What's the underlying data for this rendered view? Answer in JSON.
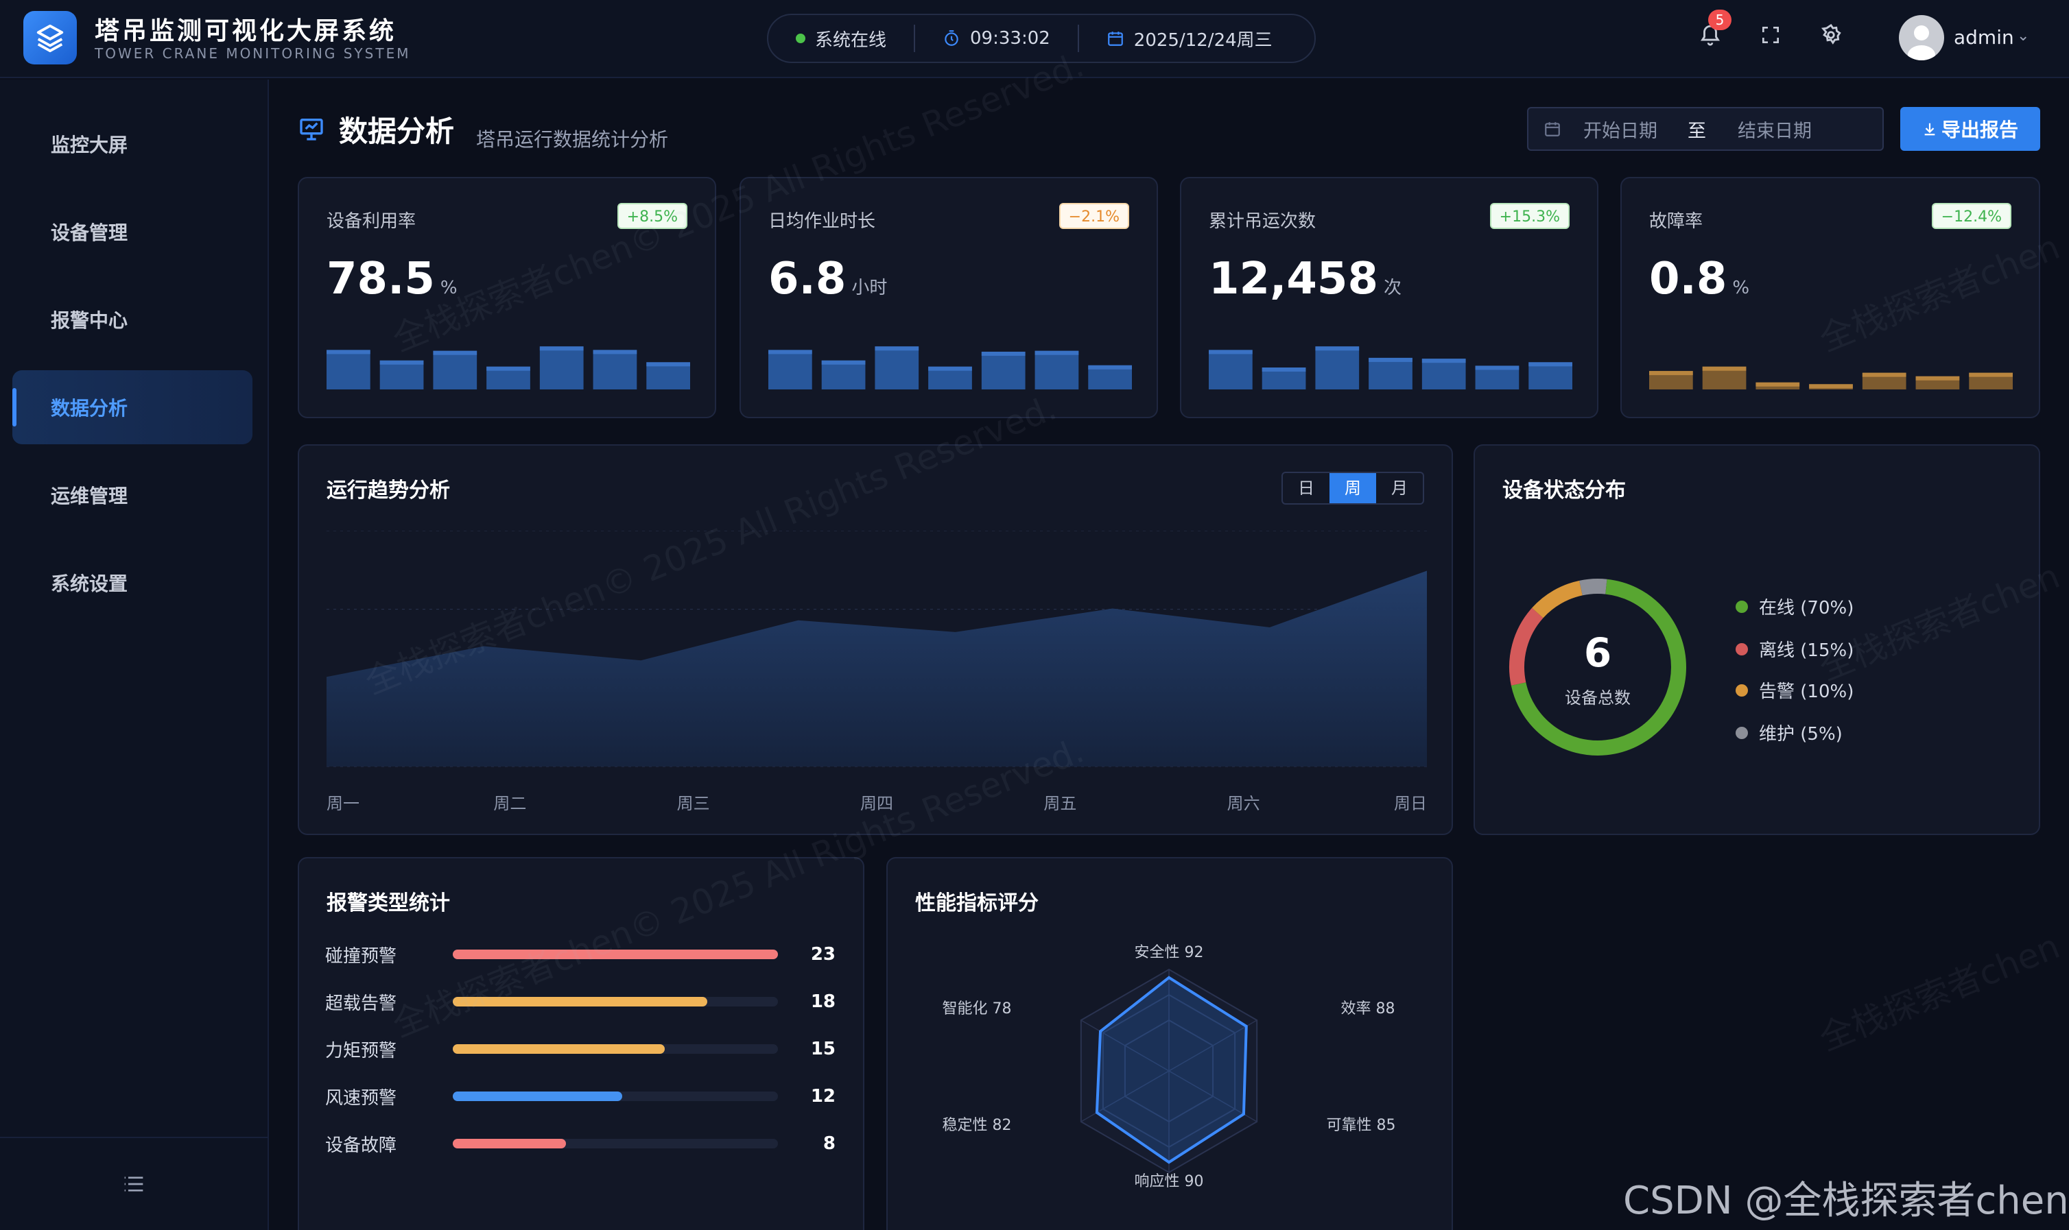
{
  "header": {
    "title": "塔吊监测可视化大屏系统",
    "subtitle": "TOWER CRANE MONITORING SYSTEM",
    "status": "系统在线",
    "time": "09:33:02",
    "date": "2025/12/24周三",
    "notification_count": "5",
    "user": "admin"
  },
  "sidebar": {
    "items": [
      {
        "label": "监控大屏",
        "active": false
      },
      {
        "label": "设备管理",
        "active": false
      },
      {
        "label": "报警中心",
        "active": false
      },
      {
        "label": "数据分析",
        "active": true
      },
      {
        "label": "运维管理",
        "active": false
      },
      {
        "label": "系统设置",
        "active": false
      }
    ]
  },
  "page": {
    "title": "数据分析",
    "subtitle": "塔吊运行数据统计分析",
    "start_placeholder": "开始日期",
    "range_sep": "至",
    "end_placeholder": "结束日期",
    "export_label": "导出报告"
  },
  "kpis": [
    {
      "label": "设备利用率",
      "value": "78.5",
      "unit": "%",
      "change": "+8.5%",
      "trend": "up",
      "color": "#2b5ea8",
      "spark": [
        0.9,
        0.66,
        0.88,
        0.52,
        0.98,
        0.9,
        0.62
      ]
    },
    {
      "label": "日均作业时长",
      "value": "6.8",
      "unit": "小时",
      "change": "−2.1%",
      "trend": "down",
      "color": "#2b5ea8",
      "spark": [
        0.9,
        0.66,
        0.98,
        0.52,
        0.86,
        0.88,
        0.55
      ]
    },
    {
      "label": "累计吊运次数",
      "value": "12,458",
      "unit": "次",
      "change": "+15.3%",
      "trend": "up",
      "color": "#2b5ea8",
      "spark": [
        0.9,
        0.5,
        0.98,
        0.72,
        0.7,
        0.54,
        0.62
      ]
    },
    {
      "label": "故障率",
      "value": "0.8",
      "unit": "%",
      "change": "−12.4%",
      "trend": "up",
      "color": "#8a6331",
      "spark": [
        0.42,
        0.52,
        0.16,
        0.12,
        0.38,
        0.3,
        0.38
      ]
    }
  ],
  "trend": {
    "title": "运行趋势分析",
    "tabs": [
      "日",
      "周",
      "月"
    ],
    "active_tab": "周"
  },
  "status_dist": {
    "title": "设备状态分布",
    "total": "6",
    "total_label": "设备总数",
    "items": [
      {
        "label": "在线 (70%)",
        "pct": 70,
        "color": "#58a631"
      },
      {
        "label": "离线 (15%)",
        "pct": 15,
        "color": "#d45a5a"
      },
      {
        "label": "告警 (10%)",
        "pct": 10,
        "color": "#d9973a"
      },
      {
        "label": "维护 (5%)",
        "pct": 5,
        "color": "#8c8f98"
      }
    ]
  },
  "alarms": {
    "title": "报警类型统计",
    "max": 23,
    "items": [
      {
        "label": "碰撞预警",
        "value": 23,
        "color": "#f47b7b"
      },
      {
        "label": "超载告警",
        "value": 18,
        "color": "#f0b458"
      },
      {
        "label": "力矩预警",
        "value": 15,
        "color": "#f0b458"
      },
      {
        "label": "风速预警",
        "value": 12,
        "color": "#4592f0"
      },
      {
        "label": "设备故障",
        "value": 8,
        "color": "#f47b7b"
      }
    ]
  },
  "performance": {
    "title": "性能指标评分",
    "axes": [
      {
        "label": "安全性",
        "value": 92
      },
      {
        "label": "效率",
        "value": 88
      },
      {
        "label": "可靠性",
        "value": 85
      },
      {
        "label": "响应性",
        "value": 90
      },
      {
        "label": "稳定性",
        "value": 82
      },
      {
        "label": "智能化",
        "value": 78
      }
    ]
  },
  "chart_data": [
    {
      "type": "area",
      "x": [
        "周一",
        "周二",
        "周三",
        "周四",
        "周五",
        "周六",
        "周日"
      ],
      "series": [
        {
          "values": [
            3.8,
            5.1,
            4.5,
            6.2,
            5.7,
            6.7,
            5.9,
            8.3
          ]
        }
      ],
      "point_positions_note": "",
      "ylim": [
        0,
        10
      ],
      "grid": true
    }
  ],
  "watermark": "全栈探索者chen© 2025 All Rights Reserved.",
  "watermark_short": "全栈探索者chen",
  "csdn": "CSDN @全栈探索者chen"
}
